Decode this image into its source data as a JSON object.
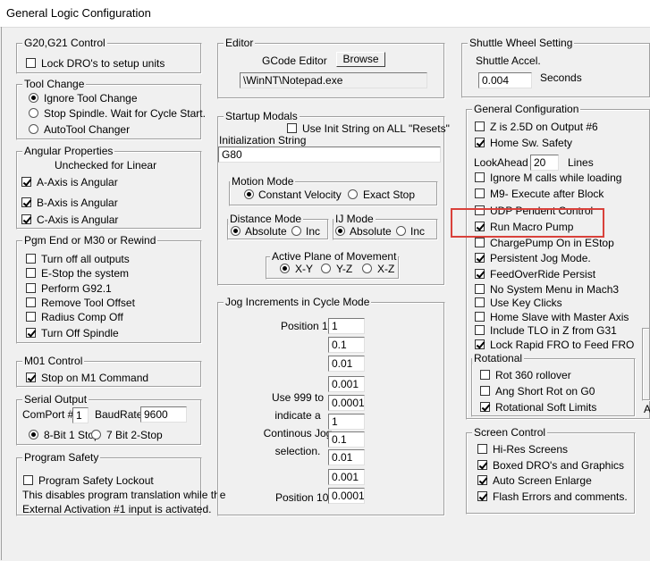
{
  "window": {
    "title": "General Logic Configuration"
  },
  "g20": {
    "legend": "G20,G21 Control",
    "lock_dro": {
      "label": "Lock DRO's to setup units",
      "checked": false
    }
  },
  "tool_change": {
    "legend": "Tool Change",
    "options": [
      {
        "label": "Ignore Tool Change",
        "selected": true
      },
      {
        "label": "Stop Spindle. Wait for Cycle Start.",
        "selected": false
      },
      {
        "label": "AutoTool Changer",
        "selected": false
      }
    ]
  },
  "angular": {
    "legend": "Angular Properties",
    "note": "Unchecked for Linear",
    "items": [
      {
        "label": "A-Axis is Angular",
        "checked": true
      },
      {
        "label": "B-Axis is Angular",
        "checked": true
      },
      {
        "label": "C-Axis is Angular",
        "checked": true
      }
    ]
  },
  "pgm_end": {
    "legend": "Pgm End or M30 or Rewind",
    "items": [
      {
        "label": "Turn off all outputs",
        "checked": false
      },
      {
        "label": "E-Stop the system",
        "checked": false
      },
      {
        "label": "Perform G92.1",
        "checked": false
      },
      {
        "label": "Remove Tool Offset",
        "checked": false
      },
      {
        "label": "Radius Comp Off",
        "checked": false
      },
      {
        "label": "Turn Off Spindle",
        "checked": true
      }
    ]
  },
  "m01": {
    "legend": "M01 Control",
    "stop_m1": {
      "label": "Stop on M1 Command",
      "checked": true
    }
  },
  "serial": {
    "legend": "Serial Output",
    "comport_label": "ComPort #",
    "comport_value": "1",
    "baud_label": "BaudRate",
    "baud_value": "9600",
    "bit8": {
      "label": "8-Bit 1 Stop",
      "selected": true
    },
    "bit7": {
      "label": "7 Bit 2-Stop",
      "selected": false
    }
  },
  "safety": {
    "legend": "Program Safety",
    "lockout": {
      "label": "Program Safety Lockout",
      "checked": false
    },
    "desc_line1": "This disables program translation while the",
    "desc_line2": "External Activation #1 input is activated."
  },
  "editor": {
    "legend": "Editor",
    "label": "GCode Editor",
    "browse": "Browse",
    "path": "\\WinNT\\Notepad.exe"
  },
  "startup": {
    "legend": "Startup Modals",
    "use_init": {
      "label": "Use Init String on ALL  \"Resets\"",
      "checked": false
    },
    "init_label": "Initialization String",
    "init_value": "G80",
    "motion": {
      "legend": "Motion Mode",
      "constant": {
        "label": "Constant Velocity",
        "selected": true
      },
      "exact": {
        "label": "Exact Stop",
        "selected": false
      }
    },
    "distance": {
      "legend": "Distance Mode",
      "absolute": {
        "label": "Absolute",
        "selected": true
      },
      "inc": {
        "label": "Inc",
        "selected": false
      }
    },
    "ij": {
      "legend": "IJ Mode",
      "absolute": {
        "label": "Absolute",
        "selected": true
      },
      "inc": {
        "label": "Inc",
        "selected": false
      }
    },
    "plane": {
      "legend": "Active Plane of Movement",
      "xy": {
        "label": "X-Y",
        "selected": true
      },
      "yz": {
        "label": "Y-Z",
        "selected": false
      },
      "xz": {
        "label": "X-Z",
        "selected": false
      }
    }
  },
  "jog": {
    "legend": "Jog Increments in Cycle Mode",
    "position1": "Position 1",
    "position10": "Position 10",
    "help_line1": "Use 999 to",
    "help_line2": "indicate a",
    "help_line3": "Continous Jog",
    "help_line4": "selection.",
    "values": [
      "1",
      "0.1",
      "0.01",
      "0.001",
      "0.0001",
      "1",
      "0.1",
      "0.01",
      "0.001",
      "0.0001"
    ]
  },
  "shuttle": {
    "legend": "Shuttle Wheel Setting",
    "accel_label": "Shuttle Accel.",
    "accel_value": "0.004",
    "seconds": "Seconds"
  },
  "general": {
    "legend": "General Configuration",
    "z25d": {
      "label": "Z is 2.5D on Output #6",
      "checked": false
    },
    "home_safety": {
      "label": "Home Sw. Safety",
      "checked": true
    },
    "lookahead_label": "LookAhead",
    "lookahead_value": "20",
    "lines": "Lines",
    "items": [
      {
        "label": "Ignore M calls while loading",
        "checked": false
      },
      {
        "label": "M9- Execute after Block",
        "checked": false
      },
      {
        "label": "UDP Pendent Control",
        "checked": false
      },
      {
        "label": "Run Macro Pump",
        "checked": true
      },
      {
        "label": "ChargePump On in EStop",
        "checked": false
      },
      {
        "label": "Persistent Jog Mode.",
        "checked": true
      },
      {
        "label": "FeedOverRide Persist",
        "checked": true
      },
      {
        "label": "No System Menu in Mach3",
        "checked": false
      },
      {
        "label": "Use Key Clicks",
        "checked": false
      },
      {
        "label": "Home Slave with Master Axis",
        "checked": false
      },
      {
        "label": "Include TLO in Z from G31",
        "checked": false
      },
      {
        "label": "Lock Rapid FRO to Feed FRO",
        "checked": true
      }
    ]
  },
  "rotational": {
    "legend": "Rotational",
    "items": [
      {
        "label": "Rot 360 rollover",
        "checked": false
      },
      {
        "label": "Ang Short Rot on G0",
        "checked": false
      },
      {
        "label": "Rotational Soft Limits",
        "checked": true
      }
    ]
  },
  "screen": {
    "legend": "Screen Control",
    "items": [
      {
        "label": "Hi-Res Screens",
        "checked": false
      },
      {
        "label": "Boxed DRO's and Graphics",
        "checked": true
      },
      {
        "label": "Auto Screen Enlarge",
        "checked": true
      },
      {
        "label": "Flash Errors and comments.",
        "checked": true
      }
    ]
  },
  "cut_off": {
    "letter": "A"
  },
  "colors": {
    "highlight": "#d9413b"
  }
}
